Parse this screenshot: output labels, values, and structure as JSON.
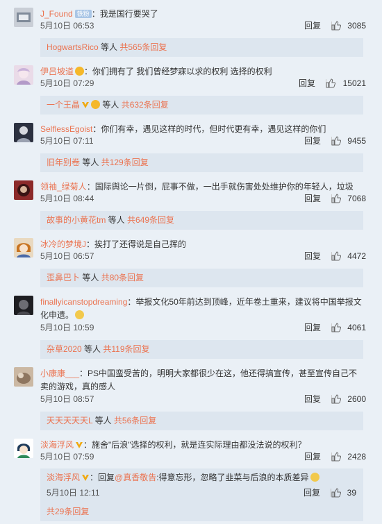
{
  "comments": [
    {
      "user": "J_Found",
      "badge": "铁粉",
      "text": "：我是国行要哭了",
      "time": "5月10日 06:53",
      "reply_label": "回复",
      "likes": "3085",
      "sub_users": "HogwartsRico",
      "sub_suffix": " 等人 ",
      "sub_count": "共565条回复"
    },
    {
      "user": "伊吕坡道",
      "text": "：你们拥有了 我们曾经梦寐以求的权利 选择的权利",
      "time": "5月10日 07:29",
      "reply_label": "回复",
      "likes": "15021",
      "sub_users": "一个王晶",
      "sub_suffix": " 等人 ",
      "sub_count": "共632条回复"
    },
    {
      "user": "SelflessEgoist",
      "text": "：你们有幸，遇见这样的时代，但时代更有幸，遇见这样的你们",
      "time": "5月10日 07:11",
      "reply_label": "回复",
      "likes": "9455",
      "sub_users": "旧年别卷",
      "sub_suffix": " 等人 ",
      "sub_count": "共129条回复"
    },
    {
      "user": "领袖_绿菊人",
      "text": "：国际舆论一片倒，屁事不做，一出手就伤害处处维护你的年轻人，垃圾",
      "time": "5月10日 08:44",
      "reply_label": "回复",
      "likes": "7068",
      "sub_users": "故事的小黄花tm",
      "sub_suffix": " 等人 ",
      "sub_count": "共649条回复"
    },
    {
      "user": "冰冷的梦境J",
      "text": "：挨打了还得说是自己挥的",
      "time": "5月10日 06:57",
      "reply_label": "回复",
      "likes": "4472",
      "sub_users": "歪鼻巴卜",
      "sub_suffix": " 等人 ",
      "sub_count": "共80条回复"
    },
    {
      "user": "finallyicanstopdreaming",
      "text_line1": "：举报文化50年前达到顶峰，近年卷土重来，建议将中国举报文",
      "text_line2": "化申遗。",
      "time": "5月10日 10:59",
      "reply_label": "回复",
      "likes": "4061",
      "sub_users": "杂草2020",
      "sub_suffix": " 等人 ",
      "sub_count": "共119条回复"
    },
    {
      "user": "小康康___",
      "text_line1": "：PS中国蛮受苦的，明明大家都很少在这，他还得搞宣传，甚至宣传自己不",
      "text_line2": "卖的游戏，真的感人",
      "time": "5月10日 08:57",
      "reply_label": "回复",
      "likes": "2600",
      "sub_users": "天天天天天L",
      "sub_suffix": " 等人 ",
      "sub_count": "共56条回复"
    },
    {
      "user": "淡海浮风",
      "text": "：施舍\"后浪\"选择的权利，就是连实际理由都没法说的权利？",
      "time": "5月10日 07:59",
      "reply_label": "回复",
      "likes": "2428",
      "reply": {
        "user": "淡海浮风",
        "prefix": "：回复",
        "mention": "@真香敬告",
        "text": ":得意忘形，忽略了韭菜与后浪的本质差异",
        "time": "5月10日 12:11",
        "reply_label": "回复",
        "likes": "39"
      },
      "sub_count": "共29条回复"
    }
  ],
  "colors": {
    "link": "#eb7350",
    "bar": "#dde6ef",
    "page": "#eaf0f6"
  }
}
